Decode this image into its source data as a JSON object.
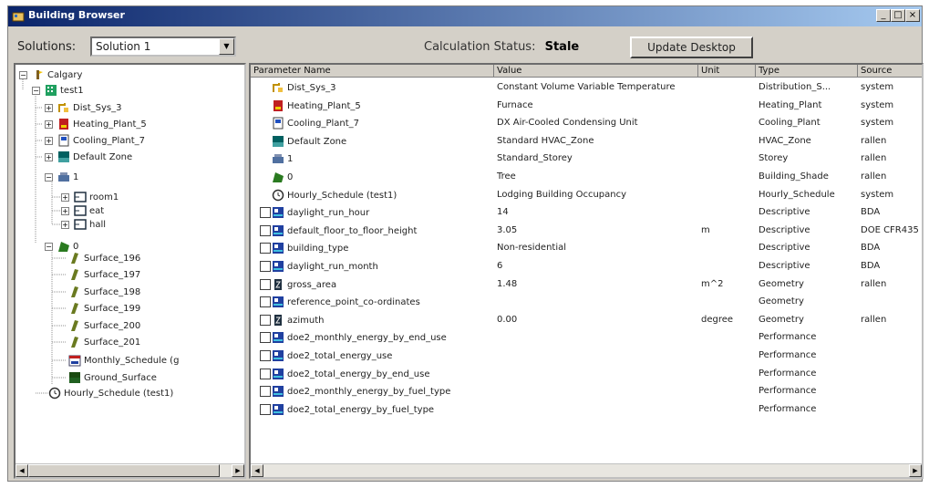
{
  "window": {
    "title": "Building Browser",
    "min_label": "_",
    "max_label": "□",
    "close_label": "×"
  },
  "toolbar": {
    "solutions_label": "Solutions:",
    "solution_value": "Solution 1",
    "status_label": "Calculation Status:",
    "status_value": "Stale",
    "update_button": "Update Desktop"
  },
  "tree": {
    "root": "Calgary",
    "building": "test1",
    "dist": "Dist_Sys_3",
    "heating": "Heating_Plant_5",
    "cooling": "Cooling_Plant_7",
    "zone": "Default Zone",
    "storey": "1",
    "room1": "room1",
    "room2": "eat",
    "room3": "hall",
    "shade": "0",
    "surf1": "Surface_196",
    "surf2": "Surface_197",
    "surf3": "Surface_198",
    "surf4": "Surface_199",
    "surf5": "Surface_200",
    "surf6": "Surface_201",
    "monthly": "Monthly_Schedule (g",
    "ground": "Ground_Surface",
    "hourly": "Hourly_Schedule (test1)"
  },
  "grid": {
    "columns": [
      "Parameter Name",
      "Value",
      "Unit",
      "Type",
      "Source"
    ],
    "rows": [
      {
        "name": "Dist_Sys_3",
        "value": "Constant Volume Variable Temperature",
        "unit": "",
        "type": "Distribution_S...",
        "source": "system",
        "icon": "dist-icon"
      },
      {
        "name": "Heating_Plant_5",
        "value": "Furnace",
        "unit": "",
        "type": "Heating_Plant",
        "source": "system",
        "icon": "heating-icon"
      },
      {
        "name": "Cooling_Plant_7",
        "value": "DX Air-Cooled Condensing Unit",
        "unit": "",
        "type": "Cooling_Plant",
        "source": "system",
        "icon": "cooling-icon"
      },
      {
        "name": "Default Zone",
        "value": "Standard HVAC_Zone",
        "unit": "",
        "type": "HVAC_Zone",
        "source": "rallen",
        "icon": "zone-icon"
      },
      {
        "name": "1",
        "value": "Standard_Storey",
        "unit": "",
        "type": "Storey",
        "source": "rallen",
        "icon": "storey-icon"
      },
      {
        "name": "0",
        "value": "Tree",
        "unit": "",
        "type": "Building_Shade",
        "source": "rallen",
        "icon": "shade-icon"
      },
      {
        "name": "Hourly_Schedule (test1)",
        "value": "Lodging Building Occupancy",
        "unit": "",
        "type": "Hourly_Schedule",
        "source": "system",
        "icon": "clock-icon"
      },
      {
        "name": "daylight_run_hour",
        "value": "14",
        "unit": "",
        "type": "Descriptive",
        "source": "BDA",
        "icon": "param-icon"
      },
      {
        "name": "default_floor_to_floor_height",
        "value": "3.05",
        "unit": "m",
        "type": "Descriptive",
        "source": "DOE CFR435",
        "icon": "param-icon"
      },
      {
        "name": "building_type",
        "value": "Non-residential",
        "unit": "",
        "type": "Descriptive",
        "source": "BDA",
        "icon": "param-icon"
      },
      {
        "name": "daylight_run_month",
        "value": "6",
        "unit": "",
        "type": "Descriptive",
        "source": "BDA",
        "icon": "param-icon"
      },
      {
        "name": "gross_area",
        "value": "1.48",
        "unit": "m^2",
        "type": "Geometry",
        "source": "rallen",
        "icon": "geom-icon"
      },
      {
        "name": "reference_point_co-ordinates",
        "value": "",
        "unit": "",
        "type": "Geometry",
        "source": "",
        "icon": "param-icon"
      },
      {
        "name": "azimuth",
        "value": "0.00",
        "unit": "degree",
        "type": "Geometry",
        "source": "rallen",
        "icon": "geom-icon"
      },
      {
        "name": "doe2_monthly_energy_by_end_use",
        "value": "",
        "unit": "",
        "type": "Performance",
        "source": "",
        "icon": "param-icon"
      },
      {
        "name": "doe2_total_energy_use",
        "value": "",
        "unit": "",
        "type": "Performance",
        "source": "",
        "icon": "param-icon"
      },
      {
        "name": "doe2_total_energy_by_end_use",
        "value": "",
        "unit": "",
        "type": "Performance",
        "source": "",
        "icon": "param-icon"
      },
      {
        "name": "doe2_monthly_energy_by_fuel_type",
        "value": "",
        "unit": "",
        "type": "Performance",
        "source": "",
        "icon": "param-icon"
      },
      {
        "name": "doe2_total_energy_by_fuel_type",
        "value": "",
        "unit": "",
        "type": "Performance",
        "source": "",
        "icon": "param-icon"
      }
    ]
  }
}
